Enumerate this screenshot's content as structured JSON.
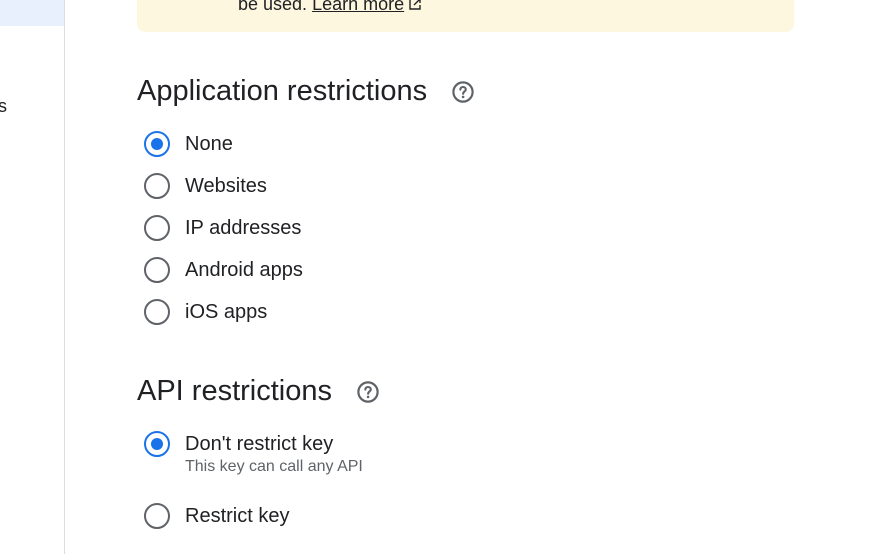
{
  "left_nav": {
    "partial_item_text": "s"
  },
  "notice": {
    "text_before_link": "be used. ",
    "link_label": "Learn more",
    "link_icon": "open-in-new-icon"
  },
  "application_restrictions": {
    "title": "Application restrictions",
    "help_icon": "help-icon",
    "options": [
      {
        "label": "None",
        "checked": true
      },
      {
        "label": "Websites",
        "checked": false
      },
      {
        "label": "IP addresses",
        "checked": false
      },
      {
        "label": "Android apps",
        "checked": false
      },
      {
        "label": "iOS apps",
        "checked": false
      }
    ]
  },
  "api_restrictions": {
    "title": "API restrictions",
    "help_icon": "help-icon",
    "options": [
      {
        "label": "Don't restrict key",
        "description": "This key can call any API",
        "checked": true
      },
      {
        "label": "Restrict key",
        "checked": false
      }
    ]
  },
  "colors": {
    "accent": "#1a73e8",
    "notice_bg": "#fef7e0",
    "text_primary": "#202124",
    "text_secondary": "#5f6368"
  }
}
